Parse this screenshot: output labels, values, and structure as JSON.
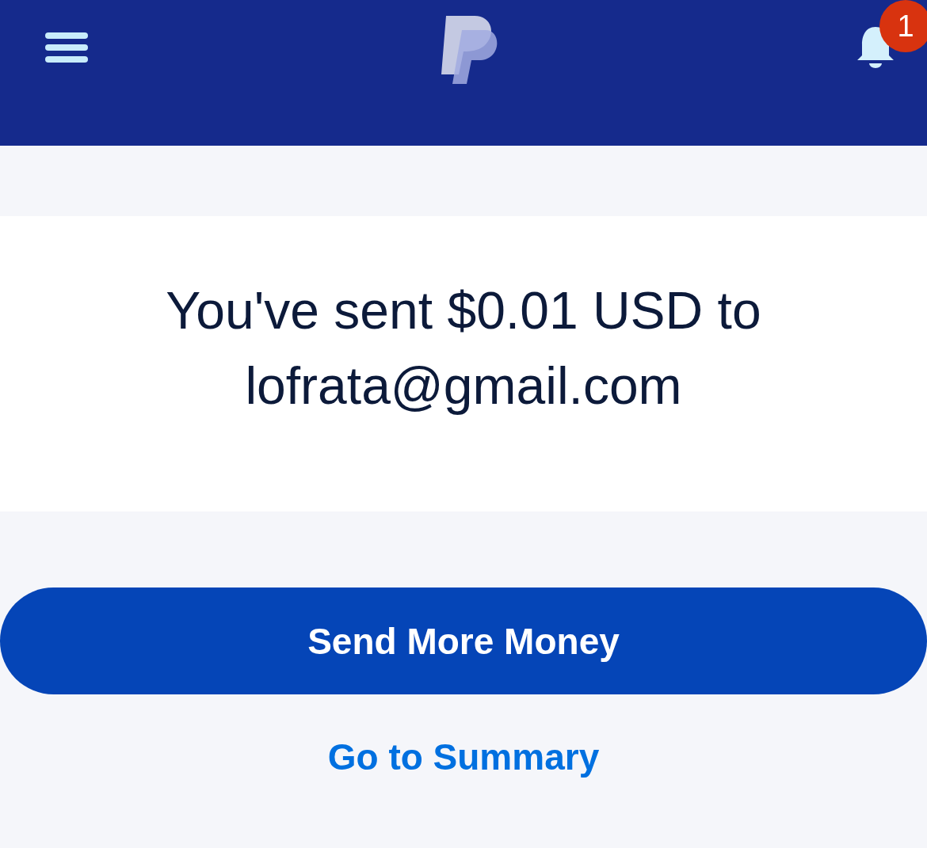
{
  "header": {
    "notification_badge": "1"
  },
  "confirmation": {
    "message": "You've sent $0.01 USD to lofrata@gmail.com"
  },
  "primary_button": {
    "label": "Send More Money"
  },
  "secondary_link": {
    "label": "Go to Summary"
  }
}
